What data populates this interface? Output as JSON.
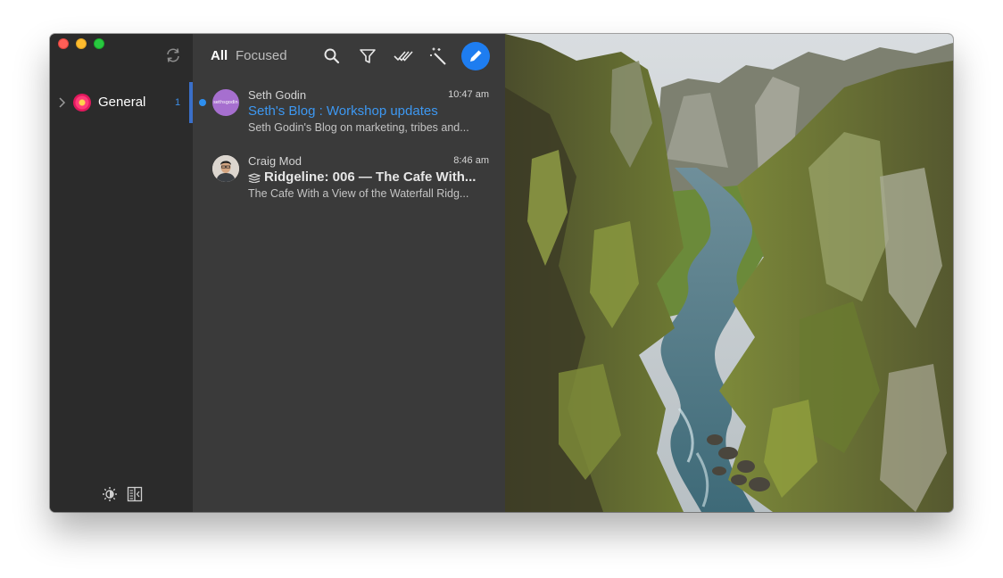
{
  "sidebar": {
    "account": {
      "name": "General",
      "count": "1"
    }
  },
  "list": {
    "tabs": {
      "all": "All",
      "focused": "Focused"
    },
    "toolbar": {
      "search_icon": "search-icon",
      "filter_icon": "filter-icon",
      "mark_all_read_icon": "double-check-icon",
      "magic_icon": "magic-wand-icon",
      "compose_icon": "pencil-icon"
    },
    "messages": [
      {
        "sender": "Seth Godin",
        "time": "10:47 am",
        "subject": "Seth's Blog : Workshop updates",
        "preview": "Seth Godin's Blog on marketing, tribes and...",
        "avatar_text": "sethsgodin",
        "unread": true
      },
      {
        "sender": "Craig Mod",
        "time": "8:46 am",
        "subject": "Ridgeline: 006 — The Cafe With...",
        "preview": "The Cafe With a View of the Waterfall Ridg...",
        "unread": false
      }
    ]
  },
  "colors": {
    "accent": "#1e7df0",
    "unread_subject": "#3d98f2",
    "sidebar_bg": "#2b2b2b",
    "list_bg": "#3a3a3a"
  }
}
